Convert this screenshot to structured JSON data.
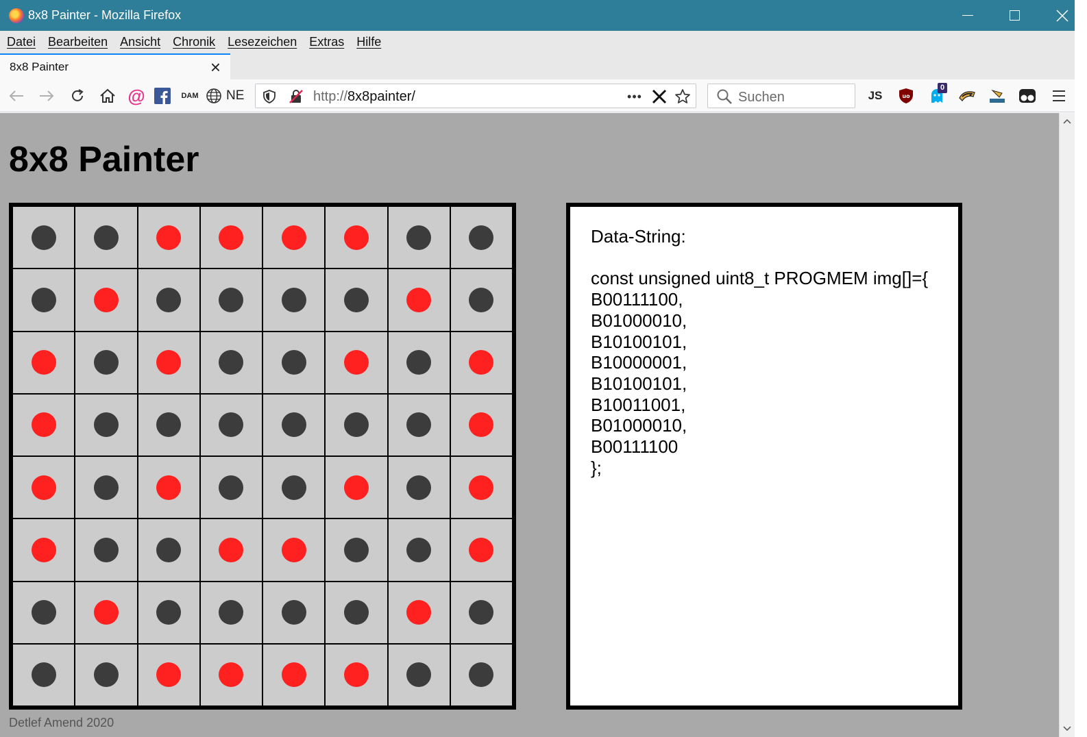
{
  "window": {
    "title": "8x8 Painter - Mozilla Firefox",
    "controls": {
      "minimize": "minimize-icon",
      "maximize": "maximize-icon",
      "close": "close-icon"
    }
  },
  "menu": [
    "Datei",
    "Bearbeiten",
    "Ansicht",
    "Chronik",
    "Lesezeichen",
    "Extras",
    "Hilfe"
  ],
  "tab": {
    "title": "8x8 Painter",
    "close": "×"
  },
  "toolbar": {
    "bookmark_ne_label": "NE",
    "bookmark_dam_label": "DAM",
    "js_label": "JS",
    "ghostery_badge": "0"
  },
  "urlbar": {
    "protocol": "http://",
    "host": "8x8painter/",
    "more": "•••"
  },
  "search": {
    "placeholder": "Suchen"
  },
  "page": {
    "title": "8x8 Painter",
    "footer": "Detlef Amend 2020",
    "colors": {
      "on": "#ff2020",
      "off": "#3c3c3c",
      "cell": "#cccccc"
    },
    "matrix": [
      "00111100",
      "01000010",
      "10100101",
      "10000001",
      "10100101",
      "10011001",
      "01000010",
      "00111100"
    ],
    "data_box": {
      "heading": "Data-String:",
      "decl": "const unsigned uint8_t PROGMEM img[]={",
      "rows": [
        "B00111100,",
        "B01000010,",
        "B10100101,",
        "B10000001,",
        "B10100101,",
        "B10011001,",
        "B01000010,",
        "B00111100"
      ],
      "close": "};"
    }
  }
}
